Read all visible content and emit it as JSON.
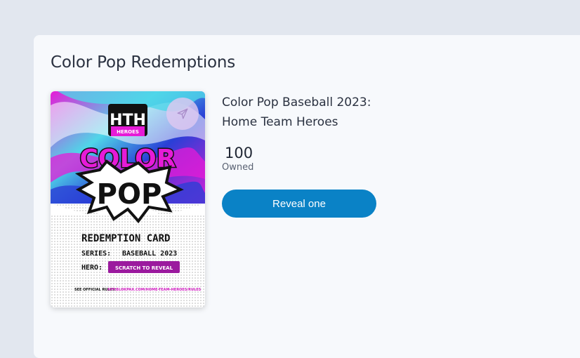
{
  "panel": {
    "title": "Color Pop Redemptions"
  },
  "item": {
    "title_line1": "Color Pop Baseball 2023:",
    "title_line2": "Home Team Heroes",
    "owned_count": "100",
    "owned_label": "Owned",
    "reveal_label": "Reveal one",
    "send_icon": "paper-plane-icon"
  },
  "card_art": {
    "logo_letters": "HTH",
    "logo_text_1": "HOME",
    "logo_text_2": "TEAM",
    "logo_text_3": "HEROES",
    "word1": "COLOR",
    "word2": "POP",
    "heading": "REDEMPTION CARD",
    "series_label": "SERIES:",
    "series_value": "BASEBALL 2023",
    "hero_label": "HERO:",
    "hero_value": "SCRATCH TO REVEAL",
    "rules_prefix": "SEE OFFICIAL RULES:",
    "rules_link": "APP.BLOKPAX.COM/HOME-TEAM-HEROES/RULES"
  },
  "colors": {
    "background": "#e2e7ef",
    "panel": "#f7f9fc",
    "accent_button": "#0a82c6",
    "card_magenta": "#e61bd7",
    "card_cyan": "#4fd6e8",
    "card_blue": "#2a3fd6"
  }
}
